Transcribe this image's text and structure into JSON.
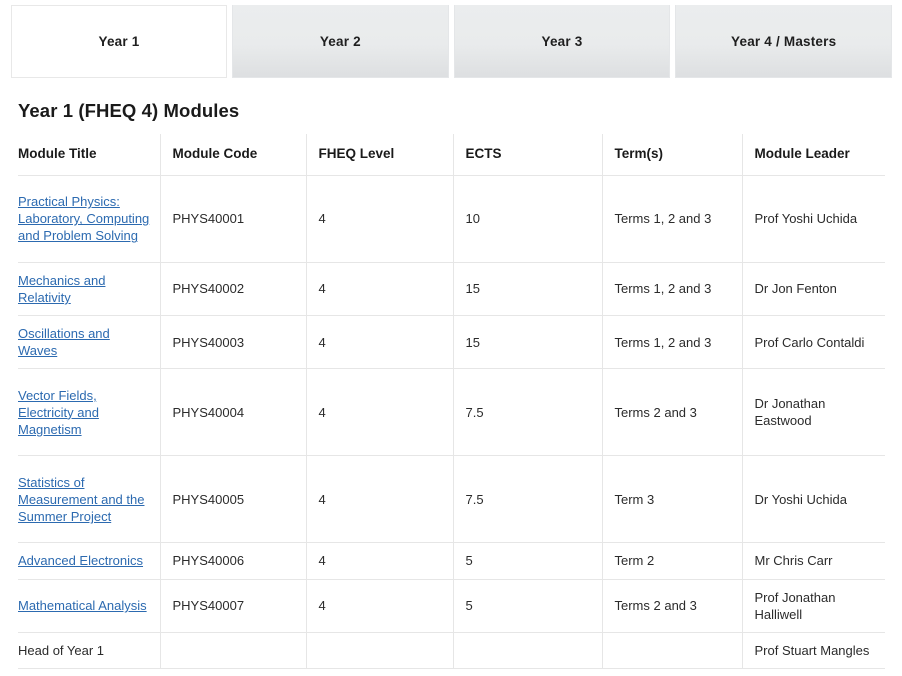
{
  "tabs": [
    {
      "label": "Year 1",
      "active": true
    },
    {
      "label": "Year 2",
      "active": false
    },
    {
      "label": "Year 3",
      "active": false
    },
    {
      "label": "Year 4 / Masters",
      "active": false
    }
  ],
  "heading": "Year 1 (FHEQ 4) Modules",
  "colors": {
    "link": "#2c6ab0",
    "border": "#e6e6e6",
    "tab_inactive_bg": "#e9ebec",
    "tab_active_bg": "#ffffff",
    "text": "#2b2b2b"
  },
  "table": {
    "columns": [
      "Module Title",
      "Module Code",
      "FHEQ Level",
      "ECTS",
      "Term(s)",
      "Module Leader"
    ],
    "rows": [
      {
        "title": "Practical Physics: Laboratory, Computing and Problem Solving",
        "title_is_link": true,
        "code": "PHYS40001",
        "fheq": "4",
        "ects": "10",
        "terms": "Terms 1, 2 and 3",
        "leader": "Prof Yoshi Uchida"
      },
      {
        "title": "Mechanics and Relativity",
        "title_is_link": true,
        "code": "PHYS40002",
        "fheq": "4",
        "ects": "15",
        "terms": "Terms 1, 2 and 3",
        "leader": "Dr Jon Fenton"
      },
      {
        "title": "Oscillations and Waves",
        "title_is_link": true,
        "code": "PHYS40003",
        "fheq": "4",
        "ects": "15",
        "terms": "Terms 1, 2 and 3",
        "leader": "Prof Carlo Contaldi"
      },
      {
        "title": "Vector Fields, Electricity and Magnetism",
        "title_is_link": true,
        "code": "PHYS40004",
        "fheq": "4",
        "ects": "7.5",
        "terms": "Terms 2 and 3",
        "leader": "Dr Jonathan Eastwood"
      },
      {
        "title": "Statistics of Measurement and the Summer Project",
        "title_is_link": true,
        "code": "PHYS40005",
        "fheq": "4",
        "ects": "7.5",
        "terms": "Term 3",
        "leader": "Dr Yoshi Uchida"
      },
      {
        "title": "Advanced Electronics",
        "title_is_link": true,
        "code": "PHYS40006",
        "fheq": "4",
        "ects": "5",
        "terms": "Term 2",
        "leader": "Mr Chris Carr"
      },
      {
        "title": "Mathematical Analysis",
        "title_is_link": true,
        "code": "PHYS40007",
        "fheq": "4",
        "ects": "5",
        "terms": "Terms 2 and 3",
        "leader": "Prof Jonathan Halliwell"
      },
      {
        "title": "Head of Year 1",
        "title_is_link": false,
        "code": "",
        "fheq": "",
        "ects": "",
        "terms": "",
        "leader": "Prof Stuart Mangles"
      }
    ]
  }
}
